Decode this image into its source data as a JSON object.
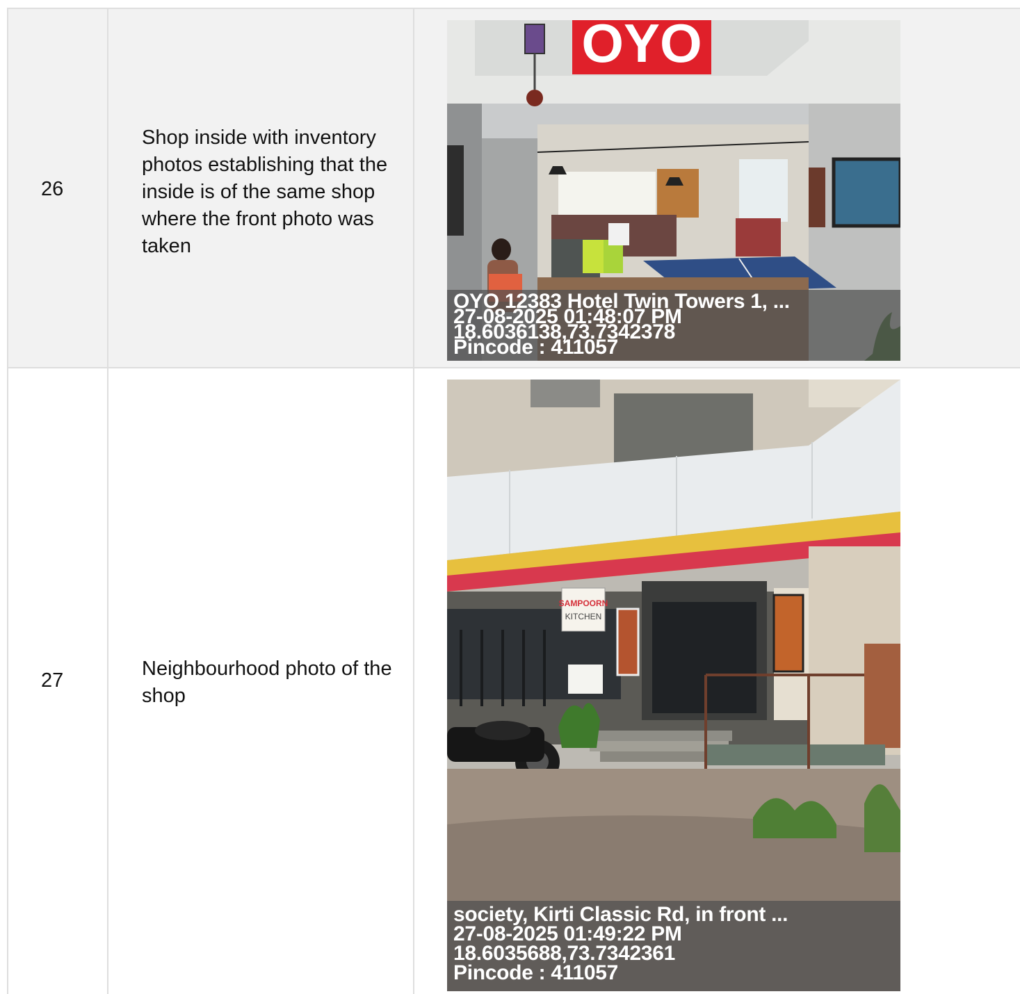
{
  "rows": [
    {
      "number": "26",
      "description": "Shop inside with inventory photos establishing that the inside is of the same shop where the front photo was taken",
      "photo": {
        "sign": "OYO",
        "stamp_lines": [
          "OYO 12383 Hotel Twin Towers 1, ...",
          "27-08-2025 01:48:07 PM",
          "18.6036138,73.7342378",
          "Pincode : 411057"
        ]
      }
    },
    {
      "number": "27",
      "description": "Neighbourhood photo of the shop",
      "photo": {
        "sign_lines": [
          "SAMPOORN",
          "KITCHEN"
        ],
        "stamp_lines": [
          "society, Kirti Classic Rd, in front ...",
          "27-08-2025 01:49:22 PM",
          "18.6035688,73.7342361",
          "Pincode : 411057"
        ]
      }
    }
  ],
  "colors": {
    "border": "#dedede",
    "row_alt_bg": "#f2f2f2",
    "oyo_red": "#e0202a"
  }
}
